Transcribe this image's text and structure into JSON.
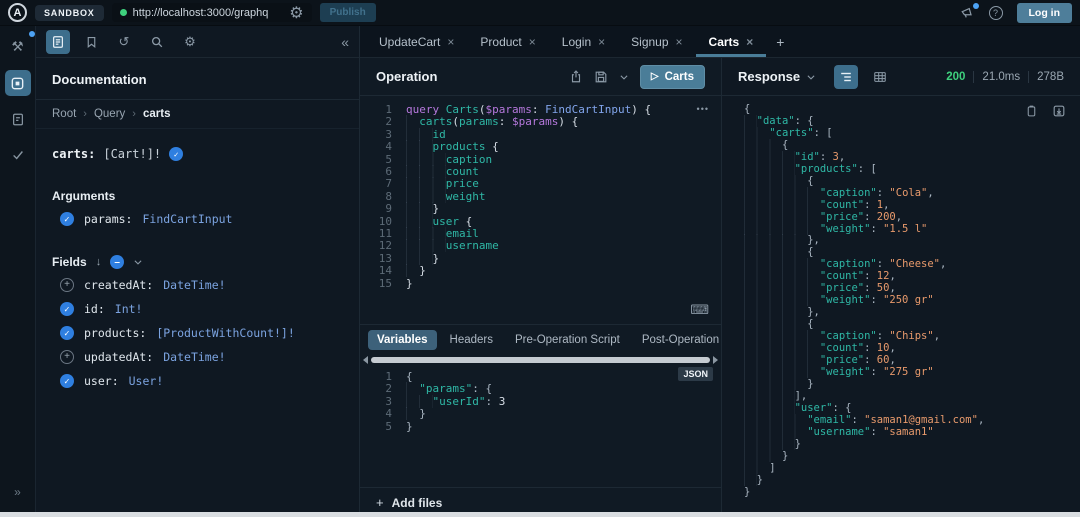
{
  "colors": {
    "accent_steel_blue": "#4a7d98",
    "status_green": "#3ed07d",
    "code_teal": "#2fb8a6",
    "code_orange": "#e89a6c",
    "code_purple": "#b678dd",
    "code_type_blue": "#82a5ec",
    "check_blue": "#2f7fe0",
    "notification_blue": "#4da3f5"
  },
  "topbar": {
    "logo": "A",
    "sandbox_label": "SANDBOX",
    "url": "http://localhost:3000/graphq",
    "publish_label": "Publish",
    "login_label": "Log in"
  },
  "tabs": {
    "items": [
      {
        "label": "UpdateCart"
      },
      {
        "label": "Product"
      },
      {
        "label": "Login"
      },
      {
        "label": "Signup"
      },
      {
        "label": "Carts"
      }
    ],
    "active": "Carts",
    "close_glyph": "×",
    "add_glyph": "+"
  },
  "docs": {
    "title": "Documentation",
    "breadcrumb": [
      "Root",
      "Query",
      "carts"
    ],
    "signature": {
      "name": "carts:",
      "type": "[Cart!]!"
    },
    "arguments_title": "Arguments",
    "arguments": [
      {
        "name": "params:",
        "type": "FindCartInput",
        "selected": true
      }
    ],
    "fields_title": "Fields",
    "fields": [
      {
        "name": "createdAt:",
        "type": "DateTime!",
        "selected": false
      },
      {
        "name": "id:",
        "type": "Int!",
        "selected": true
      },
      {
        "name": "products:",
        "type": "[ProductWithCount!]!",
        "selected": true
      },
      {
        "name": "updatedAt:",
        "type": "DateTime!",
        "selected": false
      },
      {
        "name": "user:",
        "type": "User!",
        "selected": true
      }
    ]
  },
  "operation": {
    "title": "Operation",
    "run_label": "Carts",
    "ellipsis": "•••",
    "code": [
      [
        [
          "k",
          "query"
        ],
        [
          "p",
          " "
        ],
        [
          "f",
          "Carts"
        ],
        [
          "p",
          "("
        ],
        [
          "v",
          "$params"
        ],
        [
          "p",
          ": "
        ],
        [
          "t",
          "FindCartInput"
        ],
        [
          "p",
          ") {"
        ]
      ],
      [
        [
          "ind",
          "  "
        ],
        [
          "f",
          "carts"
        ],
        [
          "p",
          "("
        ],
        [
          "f",
          "params"
        ],
        [
          "p",
          ": "
        ],
        [
          "v",
          "$params"
        ],
        [
          "p",
          ") {"
        ]
      ],
      [
        [
          "ind",
          "    "
        ],
        [
          "f",
          "id"
        ]
      ],
      [
        [
          "ind",
          "    "
        ],
        [
          "f",
          "products"
        ],
        [
          "p",
          " {"
        ]
      ],
      [
        [
          "ind",
          "      "
        ],
        [
          "f",
          "caption"
        ]
      ],
      [
        [
          "ind",
          "      "
        ],
        [
          "f",
          "count"
        ]
      ],
      [
        [
          "ind",
          "      "
        ],
        [
          "f",
          "price"
        ]
      ],
      [
        [
          "ind",
          "      "
        ],
        [
          "f",
          "weight"
        ]
      ],
      [
        [
          "ind",
          "    "
        ],
        [
          "p",
          "}"
        ]
      ],
      [
        [
          "ind",
          "    "
        ],
        [
          "f",
          "user"
        ],
        [
          "p",
          " {"
        ]
      ],
      [
        [
          "ind",
          "      "
        ],
        [
          "f",
          "email"
        ]
      ],
      [
        [
          "ind",
          "      "
        ],
        [
          "f",
          "username"
        ]
      ],
      [
        [
          "ind",
          "    "
        ],
        [
          "p",
          "}"
        ]
      ],
      [
        [
          "ind",
          "  "
        ],
        [
          "p",
          "}"
        ]
      ],
      [
        [
          "p",
          "}"
        ]
      ]
    ]
  },
  "variables": {
    "tabs": [
      "Variables",
      "Headers",
      "Pre-Operation Script",
      "Post-Operation Script"
    ],
    "active": "Variables",
    "json_badge": "JSON",
    "add_files_plus": "+",
    "add_files_label": "Add files",
    "code": [
      [
        [
          "pn",
          "{"
        ]
      ],
      [
        [
          "ind",
          "  "
        ],
        [
          "key",
          "\"params\""
        ],
        [
          "pn",
          ": {"
        ]
      ],
      [
        [
          "ind",
          "    "
        ],
        [
          "key",
          "\"userId\""
        ],
        [
          "pn",
          ": "
        ],
        [
          "n2",
          "3"
        ]
      ],
      [
        [
          "ind",
          "  "
        ],
        [
          "pn",
          "}"
        ]
      ],
      [
        [
          "pn",
          "}"
        ]
      ]
    ]
  },
  "response": {
    "title": "Response",
    "status": "200",
    "time": "21.0ms",
    "size": "278B",
    "code": [
      [
        [
          "pn",
          "{"
        ]
      ],
      [
        [
          "ind",
          "  "
        ],
        [
          "key",
          "\"data\""
        ],
        [
          "pn",
          ": {"
        ]
      ],
      [
        [
          "ind",
          "    "
        ],
        [
          "key",
          "\"carts\""
        ],
        [
          "pn",
          ": ["
        ]
      ],
      [
        [
          "ind",
          "      "
        ],
        [
          "pn",
          "{"
        ]
      ],
      [
        [
          "ind",
          "        "
        ],
        [
          "key",
          "\"id\""
        ],
        [
          "pn",
          ": "
        ],
        [
          "num",
          "3"
        ],
        [
          "pn",
          ","
        ]
      ],
      [
        [
          "ind",
          "        "
        ],
        [
          "key",
          "\"products\""
        ],
        [
          "pn",
          ": ["
        ]
      ],
      [
        [
          "ind",
          "          "
        ],
        [
          "pn",
          "{"
        ]
      ],
      [
        [
          "ind",
          "            "
        ],
        [
          "key",
          "\"caption\""
        ],
        [
          "pn",
          ": "
        ],
        [
          "str",
          "\"Cola\""
        ],
        [
          "pn",
          ","
        ]
      ],
      [
        [
          "ind",
          "            "
        ],
        [
          "key",
          "\"count\""
        ],
        [
          "pn",
          ": "
        ],
        [
          "num",
          "1"
        ],
        [
          "pn",
          ","
        ]
      ],
      [
        [
          "ind",
          "            "
        ],
        [
          "key",
          "\"price\""
        ],
        [
          "pn",
          ": "
        ],
        [
          "num",
          "200"
        ],
        [
          "pn",
          ","
        ]
      ],
      [
        [
          "ind",
          "            "
        ],
        [
          "key",
          "\"weight\""
        ],
        [
          "pn",
          ": "
        ],
        [
          "str",
          "\"1.5 l\""
        ]
      ],
      [
        [
          "ind",
          "          "
        ],
        [
          "pn",
          "},"
        ]
      ],
      [
        [
          "ind",
          "          "
        ],
        [
          "pn",
          "{"
        ]
      ],
      [
        [
          "ind",
          "            "
        ],
        [
          "key",
          "\"caption\""
        ],
        [
          "pn",
          ": "
        ],
        [
          "str",
          "\"Cheese\""
        ],
        [
          "pn",
          ","
        ]
      ],
      [
        [
          "ind",
          "            "
        ],
        [
          "key",
          "\"count\""
        ],
        [
          "pn",
          ": "
        ],
        [
          "num",
          "12"
        ],
        [
          "pn",
          ","
        ]
      ],
      [
        [
          "ind",
          "            "
        ],
        [
          "key",
          "\"price\""
        ],
        [
          "pn",
          ": "
        ],
        [
          "num",
          "50"
        ],
        [
          "pn",
          ","
        ]
      ],
      [
        [
          "ind",
          "            "
        ],
        [
          "key",
          "\"weight\""
        ],
        [
          "pn",
          ": "
        ],
        [
          "str",
          "\"250 gr\""
        ]
      ],
      [
        [
          "ind",
          "          "
        ],
        [
          "pn",
          "},"
        ]
      ],
      [
        [
          "ind",
          "          "
        ],
        [
          "pn",
          "{"
        ]
      ],
      [
        [
          "ind",
          "            "
        ],
        [
          "key",
          "\"caption\""
        ],
        [
          "pn",
          ": "
        ],
        [
          "str",
          "\"Chips\""
        ],
        [
          "pn",
          ","
        ]
      ],
      [
        [
          "ind",
          "            "
        ],
        [
          "key",
          "\"count\""
        ],
        [
          "pn",
          ": "
        ],
        [
          "num",
          "10"
        ],
        [
          "pn",
          ","
        ]
      ],
      [
        [
          "ind",
          "            "
        ],
        [
          "key",
          "\"price\""
        ],
        [
          "pn",
          ": "
        ],
        [
          "num",
          "60"
        ],
        [
          "pn",
          ","
        ]
      ],
      [
        [
          "ind",
          "            "
        ],
        [
          "key",
          "\"weight\""
        ],
        [
          "pn",
          ": "
        ],
        [
          "str",
          "\"275 gr\""
        ]
      ],
      [
        [
          "ind",
          "          "
        ],
        [
          "pn",
          "}"
        ]
      ],
      [
        [
          "ind",
          "        "
        ],
        [
          "pn",
          "],"
        ]
      ],
      [
        [
          "ind",
          "        "
        ],
        [
          "key",
          "\"user\""
        ],
        [
          "pn",
          ": {"
        ]
      ],
      [
        [
          "ind",
          "          "
        ],
        [
          "key",
          "\"email\""
        ],
        [
          "pn",
          ": "
        ],
        [
          "str",
          "\"saman1@gmail.com\""
        ],
        [
          "pn",
          ","
        ]
      ],
      [
        [
          "ind",
          "          "
        ],
        [
          "key",
          "\"username\""
        ],
        [
          "pn",
          ": "
        ],
        [
          "str",
          "\"saman1\""
        ]
      ],
      [
        [
          "ind",
          "        "
        ],
        [
          "pn",
          "}"
        ]
      ],
      [
        [
          "ind",
          "      "
        ],
        [
          "pn",
          "}"
        ]
      ],
      [
        [
          "ind",
          "    "
        ],
        [
          "pn",
          "]"
        ]
      ],
      [
        [
          "ind",
          "  "
        ],
        [
          "pn",
          "}"
        ]
      ],
      [
        [
          "pn",
          "}"
        ]
      ]
    ]
  }
}
